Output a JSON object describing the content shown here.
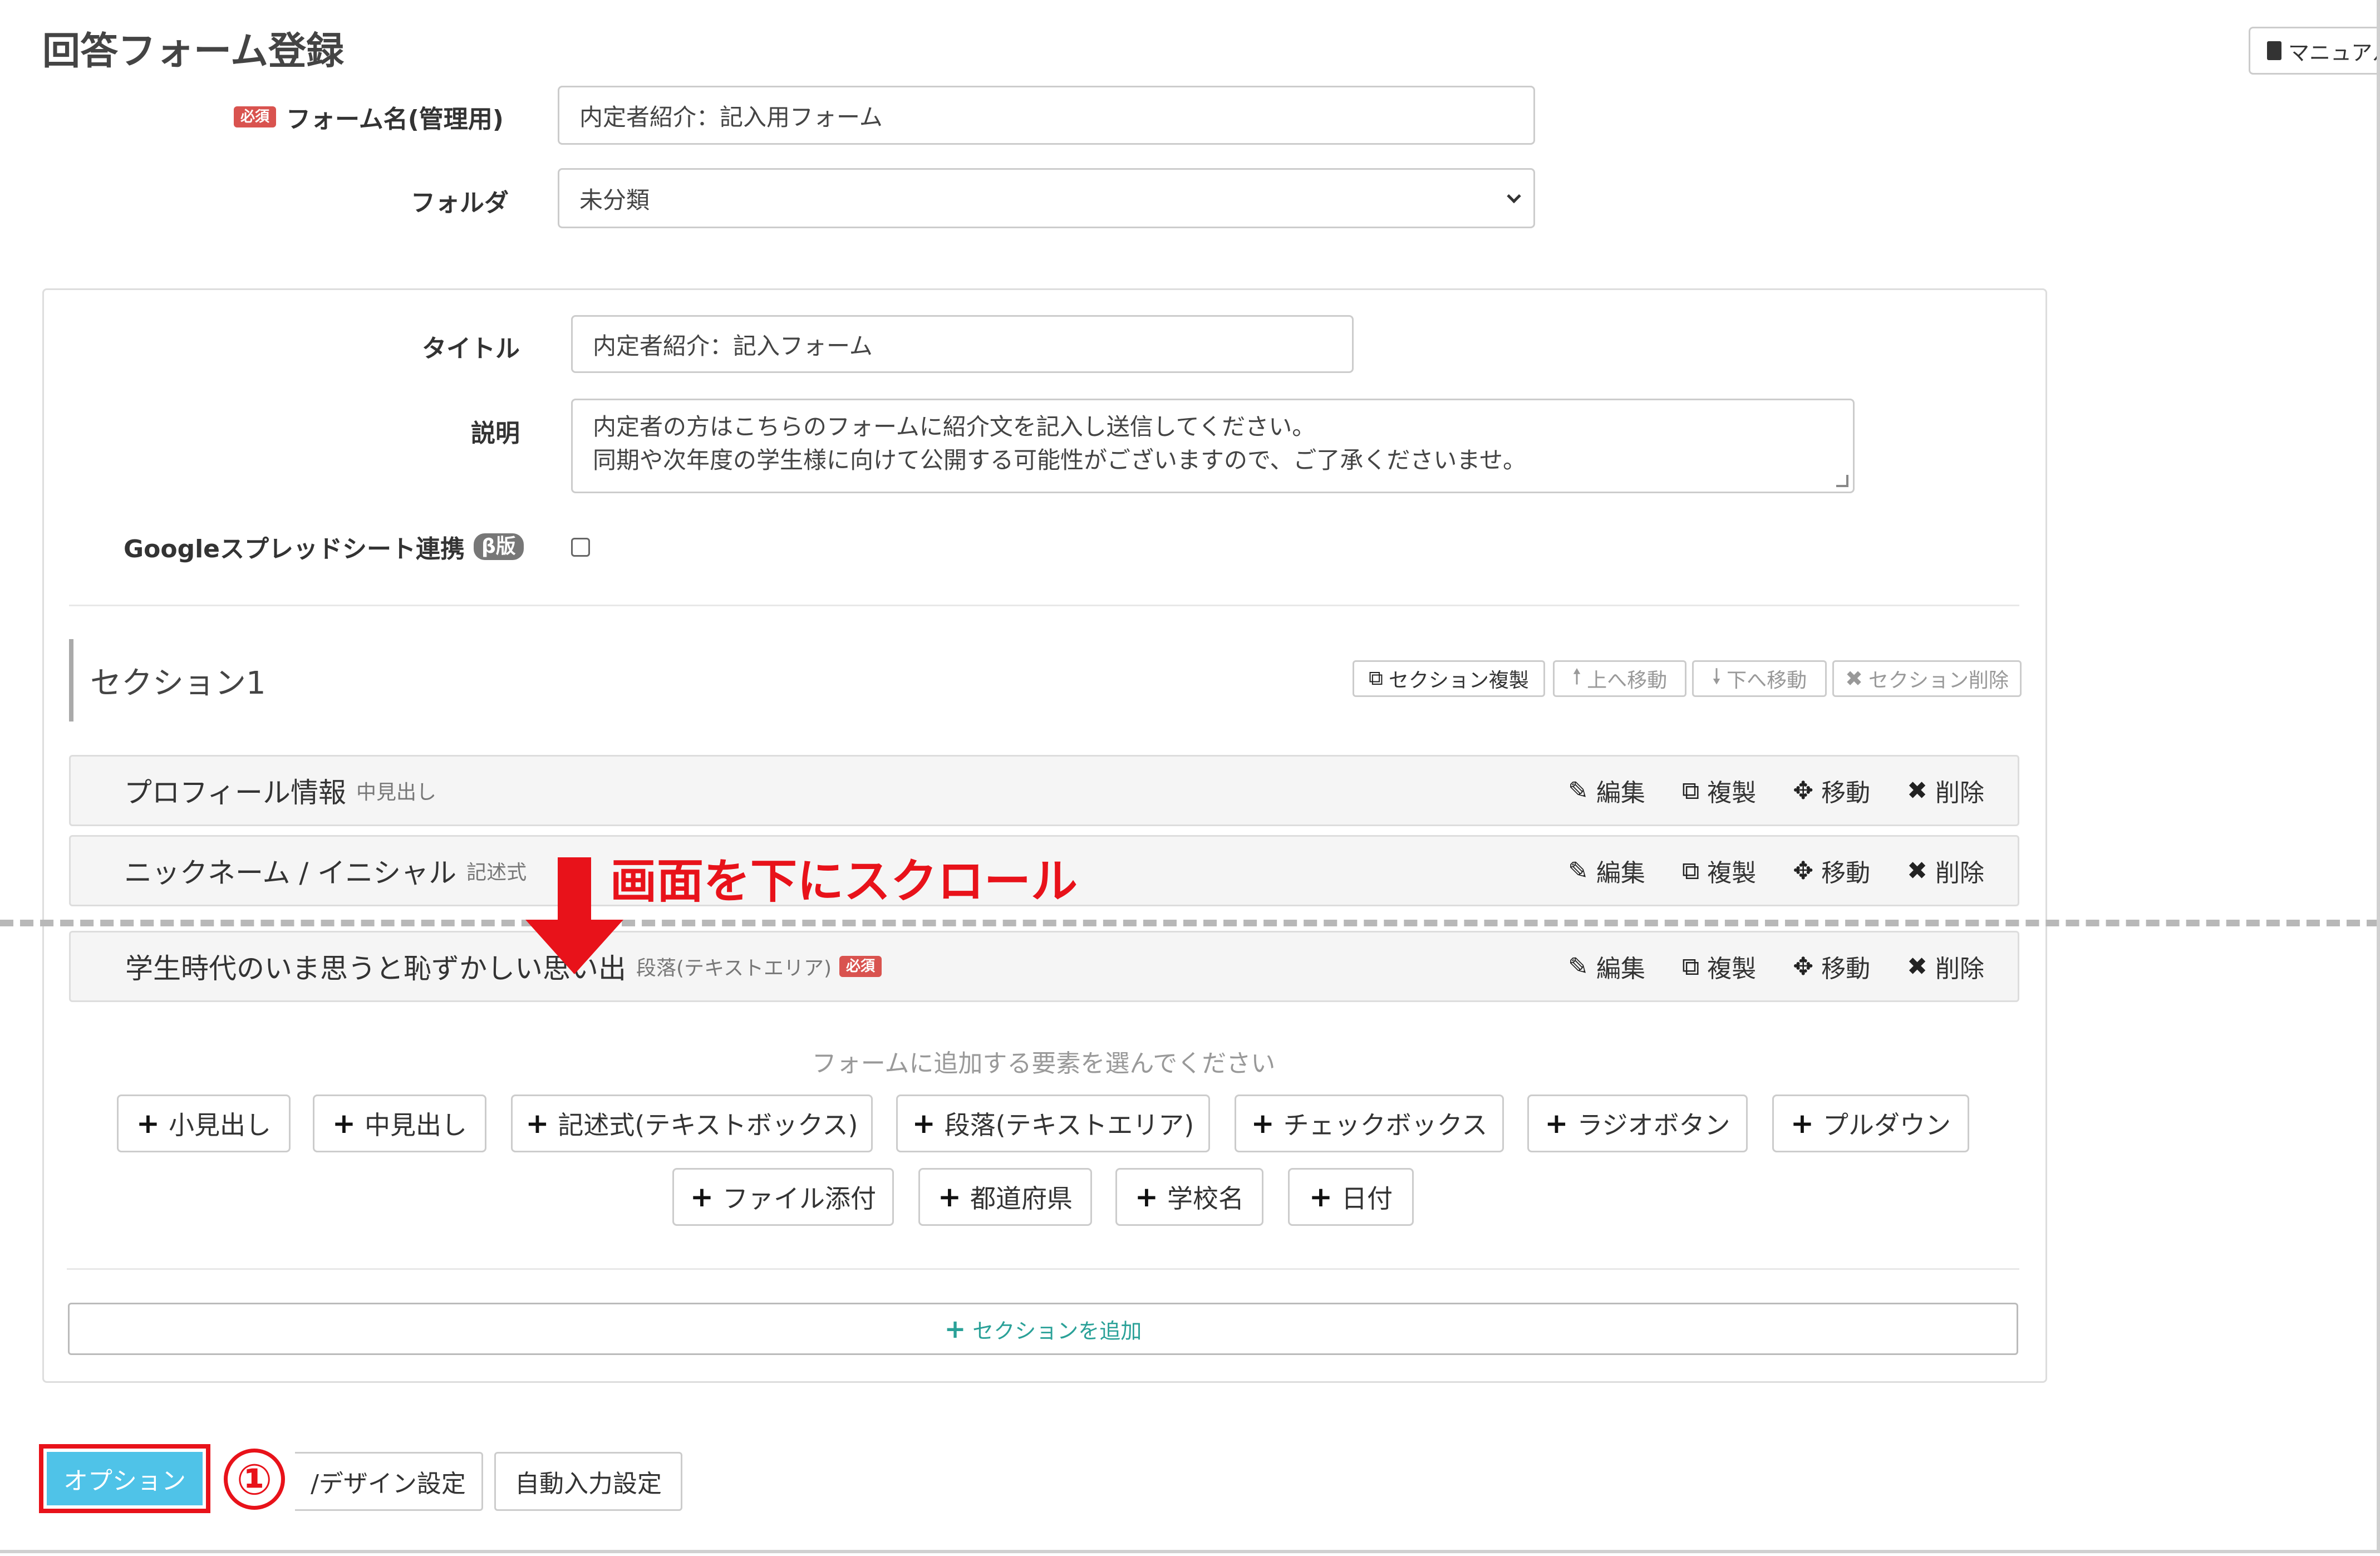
{
  "header": {
    "title": "回答フォーム登録",
    "manual_label": "マニュアル"
  },
  "form_meta": {
    "required_badge": "必須",
    "name_label": "フォーム名(管理用)",
    "name_value": "内定者紹介：記入用フォーム",
    "folder_label": "フォルダ",
    "folder_value": "未分類"
  },
  "panel": {
    "title_label": "タイトル",
    "title_value": "内定者紹介：記入フォーム",
    "description_label": "説明",
    "description_line1": "内定者の方はこちらのフォームに紹介文を記入し送信してください。",
    "description_line2": "同期や次年度の学生様に向けて公開する可能性がございますので、ご了承くださいませ。",
    "sheets_label": "Googleスプレッドシート連携",
    "beta_badge": "β版",
    "sheets_checked": false
  },
  "section": {
    "name": "セクション1",
    "buttons": {
      "duplicate": "セクション複製",
      "move_up": "上へ移動",
      "move_down": "下へ移動",
      "delete": "セクション削除"
    }
  },
  "items": [
    {
      "title": "プロフィール情報",
      "type": "中見出し",
      "required": false
    },
    {
      "title": "ニックネーム / イニシャル",
      "type": "記述式",
      "required": false
    },
    {
      "title": "学生時代のいま思うと恥ずかしい思い出",
      "type": "段落(テキストエリア)",
      "required": true
    }
  ],
  "item_actions": {
    "edit": "編集",
    "copy": "複製",
    "move": "移動",
    "delete": "削除"
  },
  "add_elements": {
    "hint": "フォームに追加する要素を選んでください",
    "row1": [
      "小見出し",
      "中見出し",
      "記述式(テキストボックス)",
      "段落(テキストエリア)",
      "チェックボックス",
      "ラジオボタン",
      "プルダウン"
    ],
    "row2": [
      "ファイル添付",
      "都道府県",
      "学校名",
      "日付"
    ]
  },
  "add_section_label": "セクションを追加",
  "bottom_tabs": {
    "options": "オプション",
    "design": "/デザイン設定",
    "autofill": "自動入力設定"
  },
  "annotations": {
    "scroll_note": "画面を下にスクロール",
    "step_number": "①"
  },
  "colors": {
    "required_red": "#d9534f",
    "highlight_red": "#e8121a",
    "options_blue": "#4fc3e8",
    "add_section_green": "#2aa198"
  }
}
